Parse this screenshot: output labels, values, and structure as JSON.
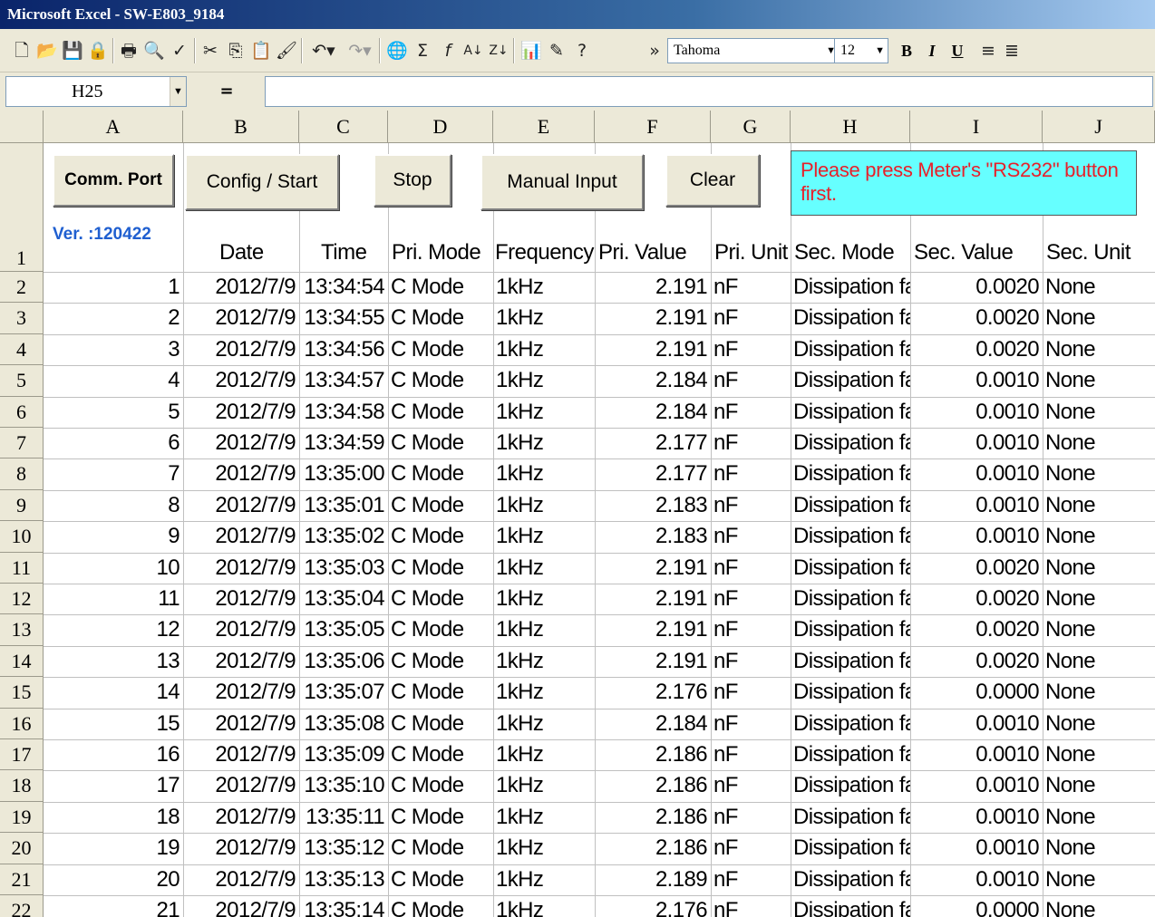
{
  "window": {
    "title": "Microsoft Excel - SW-E803_9184"
  },
  "toolbar": {
    "icons": [
      "new-icon",
      "open-icon",
      "save-icon",
      "permission-icon",
      "print-icon",
      "print-preview-icon",
      "spelling-icon",
      "cut-icon",
      "copy-icon",
      "paste-icon",
      "format-painter-icon",
      "undo-icon",
      "redo-icon",
      "hyperlink-icon",
      "autosum-icon",
      "function-icon",
      "sort-ascending-icon",
      "sort-descending-icon",
      "chart-wizard-icon",
      "drawing-icon",
      "help-icon",
      "toolbar-options-icon"
    ],
    "font": "Tahoma",
    "font_size": "12",
    "bold": "B",
    "italic": "I",
    "underline": "U"
  },
  "formula_bar": {
    "name_box": "H25",
    "equals": "="
  },
  "columns": [
    "A",
    "B",
    "C",
    "D",
    "E",
    "F",
    "G",
    "H",
    "I",
    "J"
  ],
  "row_numbers": [
    "1",
    "2",
    "3",
    "4",
    "5",
    "6",
    "7",
    "8",
    "9",
    "10",
    "11",
    "12",
    "13",
    "14",
    "15",
    "16",
    "17",
    "18",
    "19",
    "20",
    "21",
    "22"
  ],
  "buttons": {
    "comm_port": "Comm. Port",
    "config_start": "Config / Start",
    "stop": "Stop",
    "manual_input": "Manual Input",
    "clear": "Clear"
  },
  "notice": "Please press Meter's \"RS232\" button first.",
  "version": "Ver. :120422",
  "headers": [
    "Date",
    "Time",
    "Pri. Mode",
    "Frequency",
    "Pri. Value",
    "Pri. Unit",
    "Sec. Mode",
    "Sec. Value",
    "Sec. Unit"
  ],
  "rows": [
    [
      "1",
      "2012/7/9",
      "13:34:54",
      "C Mode",
      "1kHz",
      "2.191",
      "nF",
      "Dissipation fact",
      "0.0020",
      "None"
    ],
    [
      "2",
      "2012/7/9",
      "13:34:55",
      "C Mode",
      "1kHz",
      "2.191",
      "nF",
      "Dissipation fact",
      "0.0020",
      "None"
    ],
    [
      "3",
      "2012/7/9",
      "13:34:56",
      "C Mode",
      "1kHz",
      "2.191",
      "nF",
      "Dissipation fact",
      "0.0020",
      "None"
    ],
    [
      "4",
      "2012/7/9",
      "13:34:57",
      "C Mode",
      "1kHz",
      "2.184",
      "nF",
      "Dissipation fact",
      "0.0010",
      "None"
    ],
    [
      "5",
      "2012/7/9",
      "13:34:58",
      "C Mode",
      "1kHz",
      "2.184",
      "nF",
      "Dissipation fact",
      "0.0010",
      "None"
    ],
    [
      "6",
      "2012/7/9",
      "13:34:59",
      "C Mode",
      "1kHz",
      "2.177",
      "nF",
      "Dissipation fact",
      "0.0010",
      "None"
    ],
    [
      "7",
      "2012/7/9",
      "13:35:00",
      "C Mode",
      "1kHz",
      "2.177",
      "nF",
      "Dissipation fact",
      "0.0010",
      "None"
    ],
    [
      "8",
      "2012/7/9",
      "13:35:01",
      "C Mode",
      "1kHz",
      "2.183",
      "nF",
      "Dissipation fact",
      "0.0010",
      "None"
    ],
    [
      "9",
      "2012/7/9",
      "13:35:02",
      "C Mode",
      "1kHz",
      "2.183",
      "nF",
      "Dissipation fact",
      "0.0010",
      "None"
    ],
    [
      "10",
      "2012/7/9",
      "13:35:03",
      "C Mode",
      "1kHz",
      "2.191",
      "nF",
      "Dissipation fact",
      "0.0020",
      "None"
    ],
    [
      "11",
      "2012/7/9",
      "13:35:04",
      "C Mode",
      "1kHz",
      "2.191",
      "nF",
      "Dissipation fact",
      "0.0020",
      "None"
    ],
    [
      "12",
      "2012/7/9",
      "13:35:05",
      "C Mode",
      "1kHz",
      "2.191",
      "nF",
      "Dissipation fact",
      "0.0020",
      "None"
    ],
    [
      "13",
      "2012/7/9",
      "13:35:06",
      "C Mode",
      "1kHz",
      "2.191",
      "nF",
      "Dissipation fact",
      "0.0020",
      "None"
    ],
    [
      "14",
      "2012/7/9",
      "13:35:07",
      "C Mode",
      "1kHz",
      "2.176",
      "nF",
      "Dissipation fact",
      "0.0000",
      "None"
    ],
    [
      "15",
      "2012/7/9",
      "13:35:08",
      "C Mode",
      "1kHz",
      "2.184",
      "nF",
      "Dissipation fact",
      "0.0010",
      "None"
    ],
    [
      "16",
      "2012/7/9",
      "13:35:09",
      "C Mode",
      "1kHz",
      "2.186",
      "nF",
      "Dissipation fact",
      "0.0010",
      "None"
    ],
    [
      "17",
      "2012/7/9",
      "13:35:10",
      "C Mode",
      "1kHz",
      "2.186",
      "nF",
      "Dissipation fact",
      "0.0010",
      "None"
    ],
    [
      "18",
      "2012/7/9",
      "13:35:11",
      "C Mode",
      "1kHz",
      "2.186",
      "nF",
      "Dissipation fact",
      "0.0010",
      "None"
    ],
    [
      "19",
      "2012/7/9",
      "13:35:12",
      "C Mode",
      "1kHz",
      "2.186",
      "nF",
      "Dissipation fact",
      "0.0010",
      "None"
    ],
    [
      "20",
      "2012/7/9",
      "13:35:13",
      "C Mode",
      "1kHz",
      "2.189",
      "nF",
      "Dissipation fact",
      "0.0010",
      "None"
    ],
    [
      "21",
      "2012/7/9",
      "13:35:14",
      "C Mode",
      "1kHz",
      "2.176",
      "nF",
      "Dissipation fact",
      "0.0000",
      "None"
    ]
  ]
}
